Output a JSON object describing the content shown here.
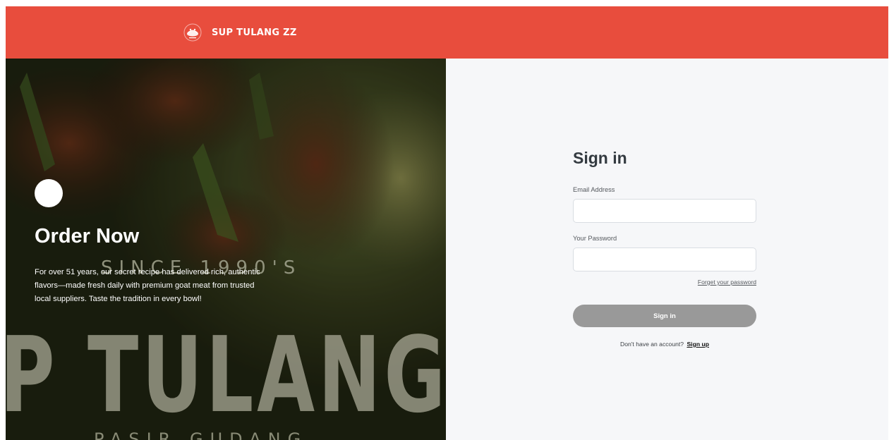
{
  "header": {
    "brand_name": "SUP TULANG ZZ",
    "logo_icon": "sup-tulang-logo-icon",
    "background_color": "#e84d3d"
  },
  "hero": {
    "title": "Order Now",
    "description": "For over 51 years, our secret recipe has delivered rich, authentic flavors—made fresh daily with premium goat meat from trusted local suppliers. Taste the tradition in every bowl!",
    "bg_text_since": "SINCE 1990'S",
    "bg_text_main": "P TULANG",
    "bg_text_bottom": "PASIR GUDANG"
  },
  "signin": {
    "heading": "Sign in",
    "email_label": "Email Address",
    "email_value": "",
    "password_label": "Your Password",
    "password_value": "",
    "forgot_label": "Forget your password",
    "button_label": "Sign in",
    "button_color": "#999999",
    "no_account_text": "Don't have an account?",
    "signup_label": "Sign up"
  }
}
